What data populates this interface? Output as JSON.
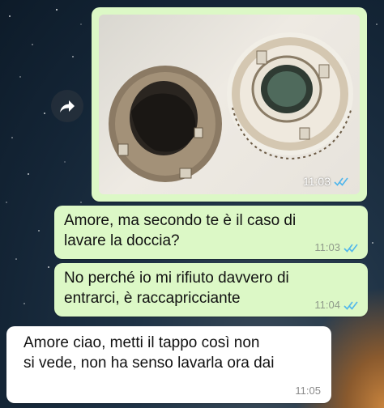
{
  "chat": {
    "messages": [
      {
        "direction": "outgoing",
        "type": "image",
        "time": "11:03",
        "status": "read"
      },
      {
        "direction": "outgoing",
        "type": "text",
        "text_line1": "Amore, ma secondo te è il caso di",
        "text_line2": "lavare la doccia?",
        "time": "11:03",
        "status": "read"
      },
      {
        "direction": "outgoing",
        "type": "text",
        "text_line1": "No perché io mi rifiuto davvero di",
        "text_line2": "entrarci, è raccapricciante",
        "time": "11:04",
        "status": "read"
      },
      {
        "direction": "incoming",
        "type": "text",
        "text_line1": "Amore ciao, metti il tappo così non",
        "text_line2": "si vede, non ha senso lavarla ora dai",
        "time": "11:05"
      }
    ]
  },
  "colors": {
    "outgoing_bubble": "#dcf8c6",
    "incoming_bubble": "#ffffff",
    "read_ticks": "#4fb6ec"
  },
  "icons": {
    "forward": "forward-arrow-icon",
    "read_receipt": "double-check-icon"
  }
}
